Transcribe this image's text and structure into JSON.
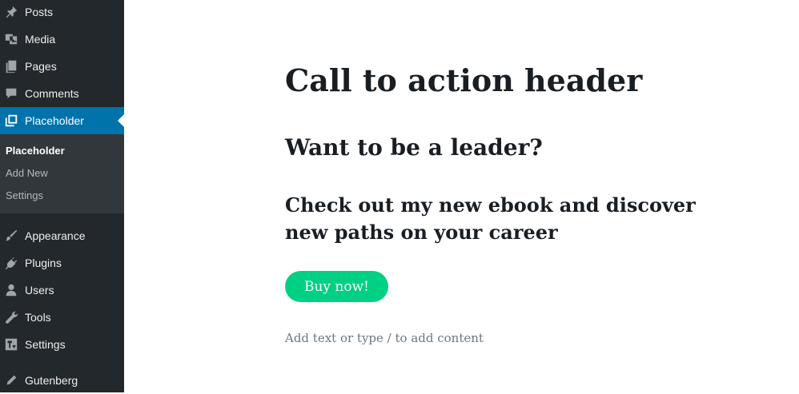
{
  "sidebar": {
    "menu": [
      {
        "label": "Posts",
        "icon": "pin-icon"
      },
      {
        "label": "Media",
        "icon": "media-icon"
      },
      {
        "label": "Pages",
        "icon": "pages-icon"
      },
      {
        "label": "Comments",
        "icon": "comment-icon"
      },
      {
        "label": "Placeholder",
        "icon": "placeholder-icon",
        "active": true
      }
    ],
    "submenu": [
      {
        "label": "Placeholder",
        "current": true
      },
      {
        "label": "Add New"
      },
      {
        "label": "Settings"
      }
    ],
    "menu_lower": [
      {
        "label": "Appearance",
        "icon": "brush-icon"
      },
      {
        "label": "Plugins",
        "icon": "plug-icon"
      },
      {
        "label": "Users",
        "icon": "user-icon"
      },
      {
        "label": "Tools",
        "icon": "wrench-icon"
      },
      {
        "label": "Settings",
        "icon": "settings-icon"
      },
      {
        "label": "Gutenberg",
        "icon": "pencil-icon"
      }
    ],
    "colors": {
      "background": "#23282d",
      "submenu": "#32373c",
      "active": "#0073aa"
    }
  },
  "editor": {
    "heading1": "Call to action header",
    "heading2": "Want to be a leader?",
    "heading3": "Check out my new ebook and discover new paths on your career",
    "button_label": "Buy now!",
    "button_color": "#00d084",
    "placeholder": "Add text or type / to add content"
  }
}
